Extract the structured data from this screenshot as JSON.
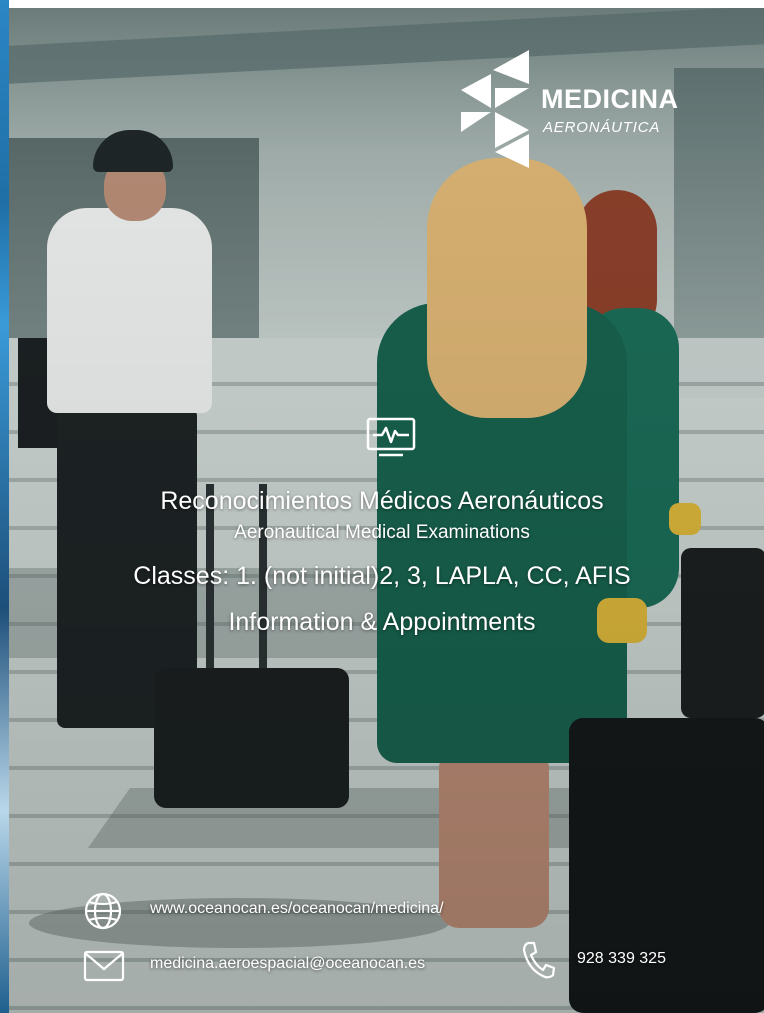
{
  "logo": {
    "title": "MEDICINA",
    "subtitle": "AERONÁUTICA"
  },
  "main": {
    "title": "Reconocimientos Médicos Aeronáuticos",
    "subtitle": "Aeronautical Medical Examinations",
    "classes": "Classes: 1. (not initial)2, 3, LAPLA, CC, AFIS",
    "info": "Information & Appointments",
    "icon": "monitor-heartbeat-icon"
  },
  "contact": {
    "website": "www.oceanocan.es/oceanocan/medicina/",
    "email": "medicina.aeroespacial@oceanocan.es",
    "phone": "928 339 325",
    "icons": [
      "globe-icon",
      "mail-icon",
      "phone-icon"
    ]
  },
  "colors": {
    "text": "#ffffff",
    "uniform_green": "#17604c",
    "side_strip": "#2b86c4"
  }
}
